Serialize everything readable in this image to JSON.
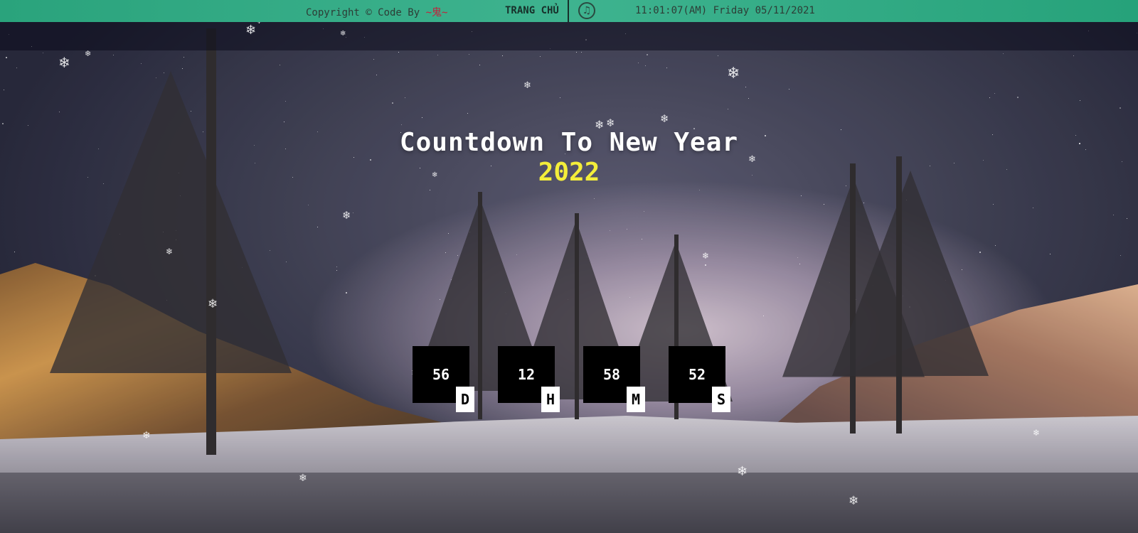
{
  "topbar": {
    "copyright_prefix": "Copyright © Code By ",
    "author": "~鬼~",
    "home_label": "TRANG CHỦ",
    "music_icon": "music-note-icon",
    "clock_text": "11:01:07(AM) Friday 05/11/2021"
  },
  "main": {
    "title": "Countdown To New Year",
    "year": "2022",
    "countdown": [
      {
        "value": "56",
        "unit": "D"
      },
      {
        "value": "12",
        "unit": "H"
      },
      {
        "value": "58",
        "unit": "M"
      },
      {
        "value": "52",
        "unit": "S"
      }
    ]
  },
  "colors": {
    "topbar": "#2aa37c",
    "year": "#f4ee3a",
    "author": "#c4203a",
    "count_box": "#000000"
  }
}
